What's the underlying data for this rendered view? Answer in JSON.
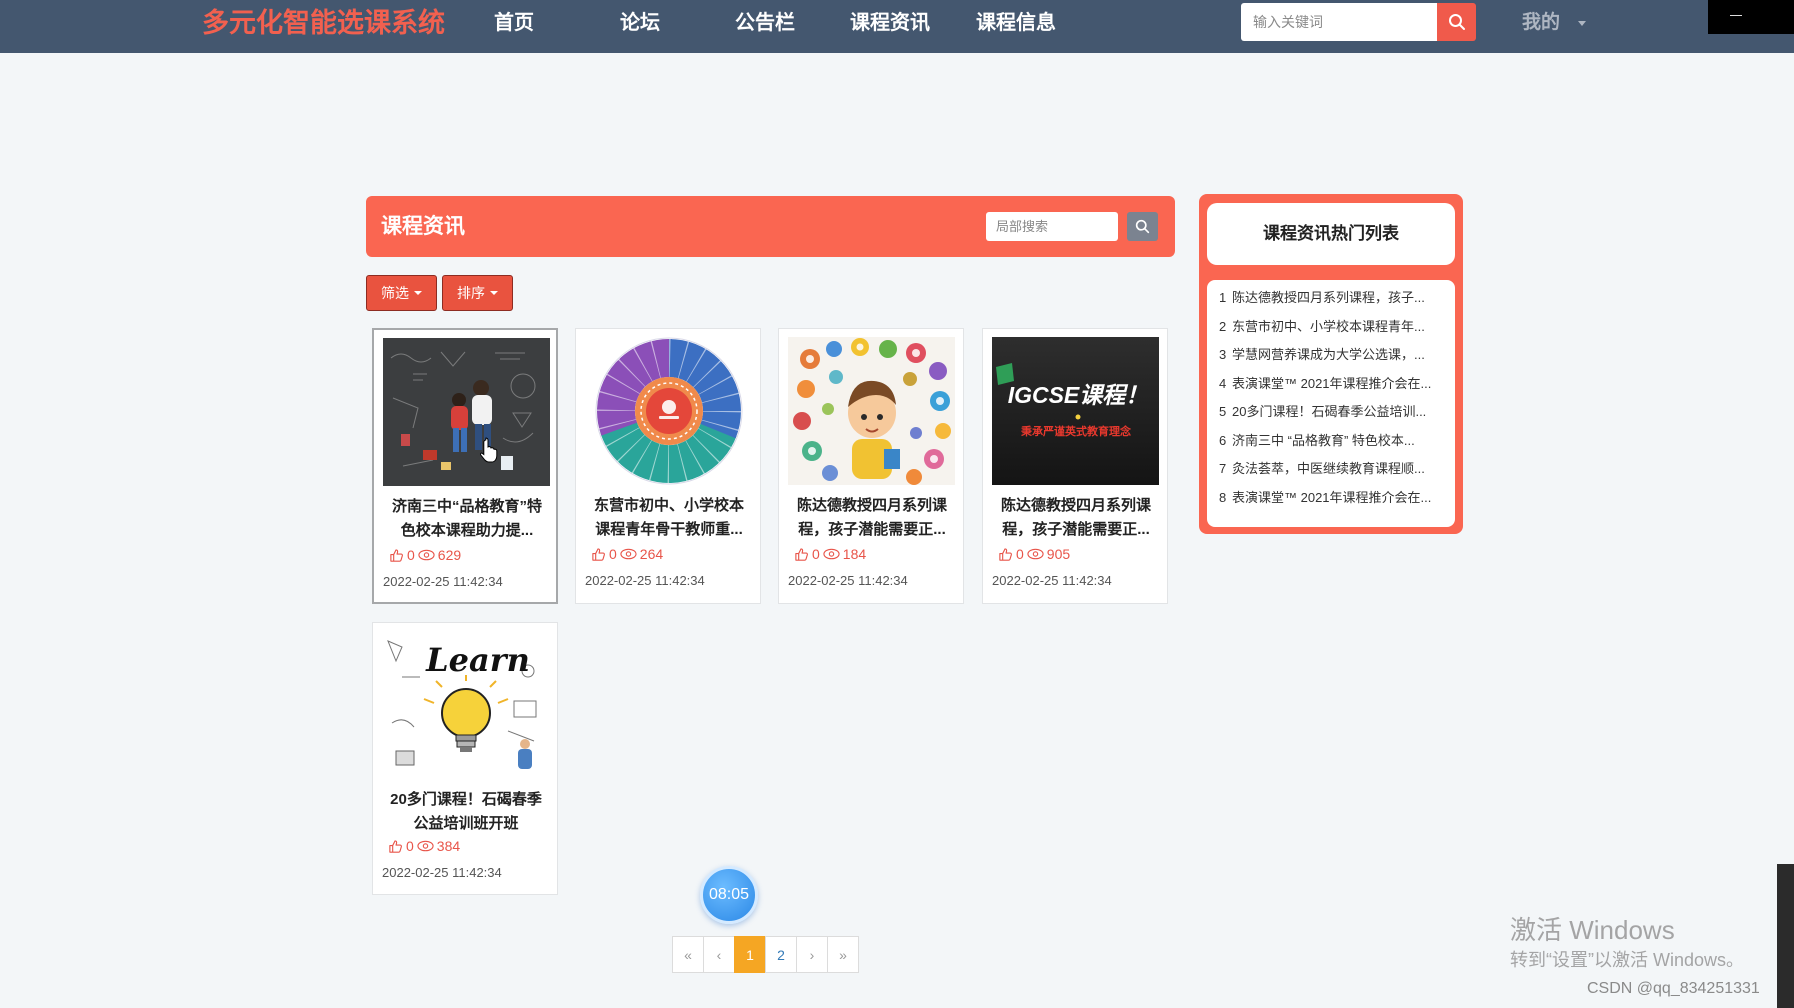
{
  "app": {
    "logo": "多元化智能选课系统"
  },
  "nav": {
    "items": [
      {
        "label": "首页"
      },
      {
        "label": "论坛"
      },
      {
        "label": "公告栏"
      },
      {
        "label": "课程资讯"
      },
      {
        "label": "课程信息"
      }
    ],
    "search_placeholder": "输入关键词",
    "search_icon": "search-icon",
    "user_menu": "我的"
  },
  "section": {
    "title": "课程资讯",
    "search_placeholder": "局部搜索"
  },
  "toolbar": {
    "filter_label": "筛选",
    "sort_label": "排序"
  },
  "articles": [
    {
      "title": "济南三中“品格教育”特色校本课程助力提...",
      "likes": "0",
      "views": "629",
      "date": "2022-02-25 11:42:34"
    },
    {
      "title": "东营市初中、小学校本课程青年骨干教师重...",
      "likes": "0",
      "views": "264",
      "date": "2022-02-25 11:42:34"
    },
    {
      "title": "陈达德教授四月系列课程，孩子潜能需要正...",
      "likes": "0",
      "views": "184",
      "date": "2022-02-25 11:42:34"
    },
    {
      "title": "陈达德教授四月系列课程，孩子潜能需要正...",
      "likes": "0",
      "views": "905",
      "date": "2022-02-25 11:42:34"
    },
    {
      "title": "20多门课程！石碣春季公益培训班开班",
      "likes": "0",
      "views": "384",
      "date": "2022-02-25 11:42:34"
    }
  ],
  "image_text": {
    "igcse_main": "IGCSE课程！",
    "igcse_sub": "秉承严谨英式教育理念",
    "learn_word": "Learn"
  },
  "hot_list": {
    "title": "课程资讯热门列表",
    "items": [
      {
        "rank": "1",
        "title": "陈达德教授四月系列课程，孩子..."
      },
      {
        "rank": "2",
        "title": "东营市初中、小学校本课程青年..."
      },
      {
        "rank": "3",
        "title": "学慧网营养课成为大学公选课，..."
      },
      {
        "rank": "4",
        "title": "表演课堂™ 2021年课程推介会在..."
      },
      {
        "rank": "5",
        "title": "20多门课程！石碣春季公益培训..."
      },
      {
        "rank": "6",
        "title": "济南三中 “品格教育” 特色校本..."
      },
      {
        "rank": "7",
        "title": "灸法荟萃，中医继续教育课程顺..."
      },
      {
        "rank": "8",
        "title": "表演课堂™ 2021年课程推介会在..."
      }
    ]
  },
  "pagination": {
    "first": "«",
    "prev": "‹",
    "pages": [
      "1",
      "2"
    ],
    "active": "1",
    "next": "›",
    "last": "»"
  },
  "clock_badge": "08:05",
  "watermark": {
    "line1": "激活 Windows",
    "line2": "转到“设置”以激活 Windows。",
    "credit": "CSDN @qq_834251331"
  },
  "colors": {
    "nav_bg": "#44576f",
    "logo": "#f2604f",
    "accent": "#fa6651",
    "button_red": "#e9533f",
    "active_page": "#f5a623",
    "stat_red": "#e8554a",
    "page_link": "#337ab7"
  }
}
